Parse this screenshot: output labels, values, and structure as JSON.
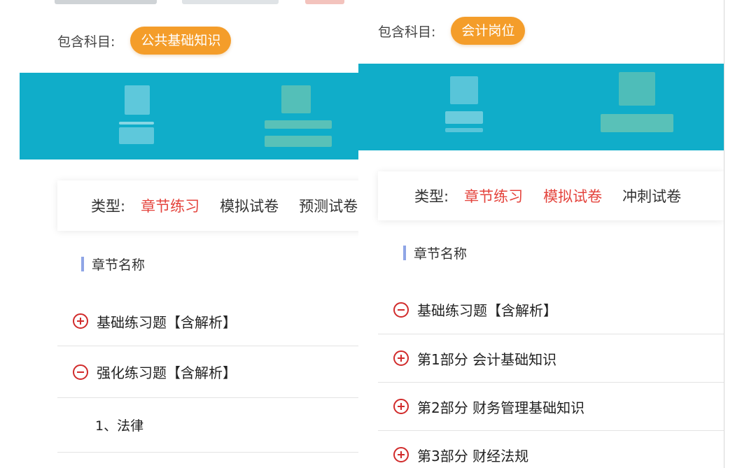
{
  "left_panel": {
    "subject_label": "包含科目:",
    "subject_pill": "公共基础知识",
    "type_label": "类型:",
    "types": [
      {
        "label": "章节练习",
        "active": true
      },
      {
        "label": "模拟试卷",
        "active": false
      },
      {
        "label": "预测试卷",
        "active": false
      }
    ],
    "section_title": "章节名称",
    "rows": [
      {
        "label": "基础练习题【含解析】",
        "icon": "plus-circle-icon"
      },
      {
        "label": "强化练习题【含解析】",
        "icon": "minus-circle-icon"
      },
      {
        "label": "1、法律",
        "icon": ""
      }
    ]
  },
  "right_panel": {
    "subject_label": "包含科目:",
    "subject_pill": "会计岗位",
    "type_label": "类型:",
    "types": [
      {
        "label": "章节练习",
        "active": true
      },
      {
        "label": "模拟试卷",
        "active": true
      },
      {
        "label": "冲刺试卷",
        "active": false
      }
    ],
    "section_title": "章节名称",
    "rows": [
      {
        "label": "基础练习题【含解析】",
        "icon": "minus-circle-icon"
      },
      {
        "label": "第1部分 会计基础知识",
        "icon": "plus-circle-icon"
      },
      {
        "label": "第2部分 财务管理基础知识",
        "icon": "plus-circle-icon"
      },
      {
        "label": "第3部分 财经法规",
        "icon": "plus-circle-icon"
      }
    ]
  },
  "colors": {
    "banner": "#10adc9",
    "pill": "#f49d2a",
    "active_type": "#e4433c",
    "icon": "#d12b2b",
    "accent_bar": "#8fa5e6"
  }
}
